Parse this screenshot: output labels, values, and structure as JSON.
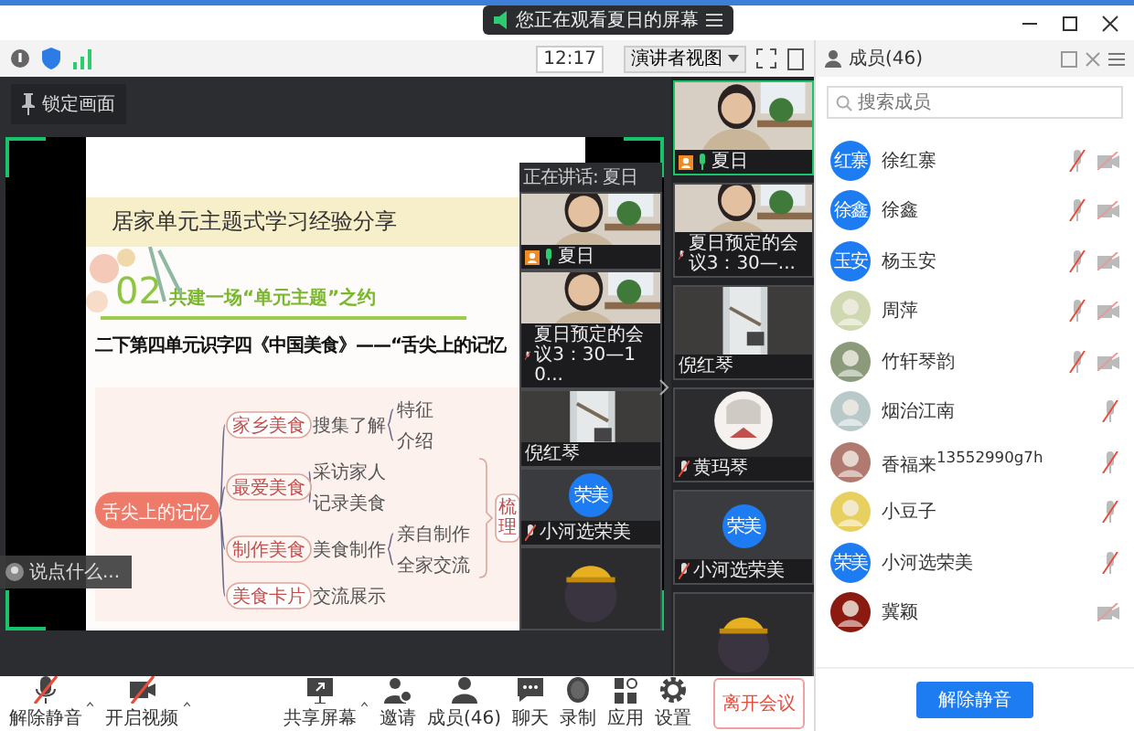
{
  "title_bar": {
    "notification": "您正在观看夏日的屏幕"
  },
  "toolbar": {
    "time": "12:17",
    "view_button": "演讲者视图"
  },
  "lock_button": "锁定画面",
  "shared_screen": {
    "slide": {
      "title": "居家单元主题式学习经验分享",
      "number": "02",
      "heading": "共建一场“单元主题”之约",
      "subtitle": "二下第四单元识字四《中国美食》——“舌尖上的记忆",
      "mind_map": {
        "center": "舌尖上的记忆",
        "summary": "梳理",
        "branches": [
          {
            "label": "家乡美食",
            "in_summary": false,
            "children": [
              {
                "label": "搜集了解",
                "children": [
                  {
                    "label": "特征"
                  },
                  {
                    "label": "介绍"
                  }
                ]
              }
            ]
          },
          {
            "label": "最爱美食",
            "in_summary": true,
            "children": [
              {
                "label": "采访家人"
              },
              {
                "label": "记录美食"
              }
            ]
          },
          {
            "label": "制作美食",
            "in_summary": true,
            "children": [
              {
                "label": "美食制作",
                "children": [
                  {
                    "label": "亲自制作"
                  },
                  {
                    "label": "全家交流"
                  }
                ]
              }
            ]
          },
          {
            "label": "美食卡片",
            "in_summary": false,
            "children": [
              {
                "label": "交流展示"
              }
            ]
          }
        ]
      }
    },
    "strip_header": "正在讲话: 夏日",
    "video_strip": [
      {
        "kind": "camera",
        "label": "夏日",
        "speaking": true,
        "muted": false,
        "host": true,
        "active": false
      },
      {
        "kind": "camera",
        "label": "夏日预定的会议3：30—10...",
        "speaking": false,
        "muted": true,
        "host": false,
        "active": false
      },
      {
        "kind": "room",
        "label": "倪红琴",
        "speaking": false,
        "muted": false,
        "host": false,
        "active": false
      },
      {
        "avatar_text": "荣美",
        "label": "小河选荣美",
        "speaking": false,
        "muted": true,
        "host": false,
        "active": false
      },
      {
        "kind": "hat",
        "speaking": false,
        "muted": false,
        "host": false,
        "active": false
      }
    ],
    "chat_placeholder": "说点什么..."
  },
  "video_column": [
    {
      "kind": "camera",
      "label": "夏日",
      "speaking": true,
      "muted": false,
      "host": true,
      "active": true
    },
    {
      "kind": "camera",
      "label": "夏日预定的会议3：30—...",
      "speaking": false,
      "muted": true,
      "host": false,
      "active": false
    },
    {
      "kind": "room",
      "label": "倪红琴",
      "speaking": false,
      "muted": false,
      "host": false,
      "active": false
    },
    {
      "kind": "cartoon",
      "label": "黄玛琴",
      "speaking": false,
      "muted": true,
      "host": false,
      "active": false
    },
    {
      "avatar_text": "荣美",
      "label": "小河选荣美",
      "speaking": false,
      "muted": true,
      "host": false,
      "active": false
    },
    {
      "kind": "hat",
      "speaking": false,
      "muted": false,
      "host": false,
      "active": false
    }
  ],
  "members_panel": {
    "title": "成员(46)",
    "search_placeholder": "搜索成员",
    "members": [
      {
        "name": "徐红寨",
        "kind": "text",
        "avatar_text": "红寨",
        "mic_off": true,
        "camera_off": true
      },
      {
        "name": "徐鑫",
        "kind": "text",
        "avatar_text": "徐鑫",
        "mic_off": true,
        "camera_off": true
      },
      {
        "name": "杨玉安",
        "kind": "text",
        "avatar_text": "玉安",
        "mic_off": true,
        "camera_off": true
      },
      {
        "name": "周萍",
        "kind": "picture",
        "color": "#cfd8b0",
        "mic_off": true,
        "camera_off": true
      },
      {
        "name": "竹轩琴韵",
        "kind": "picture",
        "color": "#8a9a7a",
        "mic_off": true,
        "camera_off": true
      },
      {
        "name": "烟治江南",
        "kind": "picture",
        "color": "#b9c9c9",
        "mic_off": true,
        "camera_off": false
      },
      {
        "name": "香福来$^{13552990g7h}$",
        "kind": "picture",
        "color": "#b07a70",
        "mic_off": true,
        "camera_off": false
      },
      {
        "name": "小豆子",
        "kind": "picture",
        "color": "#e8d060",
        "mic_off": true,
        "camera_off": false
      },
      {
        "name": "小河选荣美",
        "kind": "text",
        "avatar_text": "荣美",
        "mic_off": true,
        "camera_off": false
      },
      {
        "name": "冀颖",
        "kind": "picture",
        "color": "#8b1a10",
        "mic_off": false,
        "camera_off": true
      }
    ],
    "unmute_button": "解除静音"
  },
  "bottom_bar": {
    "buttons": [
      {
        "kind": "mic",
        "label": "解除静音",
        "off": true,
        "caret": true
      },
      {
        "kind": "video",
        "label": "开启视频",
        "off": true,
        "caret": true
      },
      {
        "kind": "share",
        "label": "共享屏幕",
        "off": false,
        "caret": true
      },
      {
        "kind": "invite",
        "label": "邀请",
        "off": false,
        "caret": false
      },
      {
        "kind": "members",
        "label": "成员(46)",
        "off": false,
        "caret": false
      },
      {
        "kind": "chat",
        "label": "聊天",
        "off": false,
        "caret": false
      },
      {
        "kind": "record",
        "label": "录制",
        "off": false,
        "caret": false
      },
      {
        "kind": "apps",
        "label": "应用",
        "off": false,
        "caret": false
      },
      {
        "kind": "settings",
        "label": "设置",
        "off": false,
        "caret": false
      }
    ],
    "leave_button": "离开会议"
  }
}
